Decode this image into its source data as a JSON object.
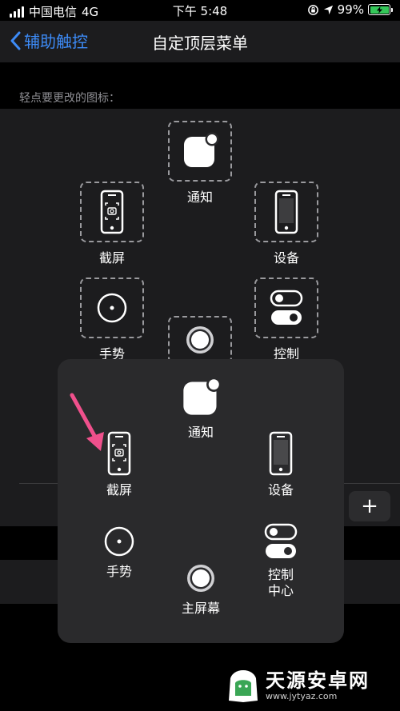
{
  "status_bar": {
    "carrier": "中国电信",
    "network": "4G",
    "time": "下午 5:48",
    "battery": "99%"
  },
  "nav": {
    "back_label": "辅助触控",
    "title": "自定顶层菜单"
  },
  "section_label": "轻点要更改的图标：",
  "editor": {
    "slots": [
      {
        "label": "通知",
        "icon": "notification-icon"
      },
      {
        "label": "截屏",
        "icon": "screenshot-icon"
      },
      {
        "label": "设备",
        "icon": "device-icon"
      },
      {
        "label": "手势",
        "icon": "gesture-icon"
      },
      {
        "label": "控制",
        "icon": "control-center-icon"
      },
      {
        "label": "",
        "icon": "home-button-icon"
      }
    ],
    "plus_label": "+"
  },
  "popup": {
    "items": [
      {
        "label": "通知",
        "icon": "notification-icon"
      },
      {
        "label": "截屏",
        "icon": "screenshot-icon"
      },
      {
        "label": "设备",
        "icon": "device-icon"
      },
      {
        "label": "手势",
        "icon": "gesture-icon"
      },
      {
        "label": "控制\n中心",
        "icon": "control-center-icon"
      },
      {
        "label": "主屏幕",
        "icon": "home-button-icon"
      }
    ]
  },
  "watermark": {
    "title": "天源安卓网",
    "url": "www.jytyaz.com"
  }
}
